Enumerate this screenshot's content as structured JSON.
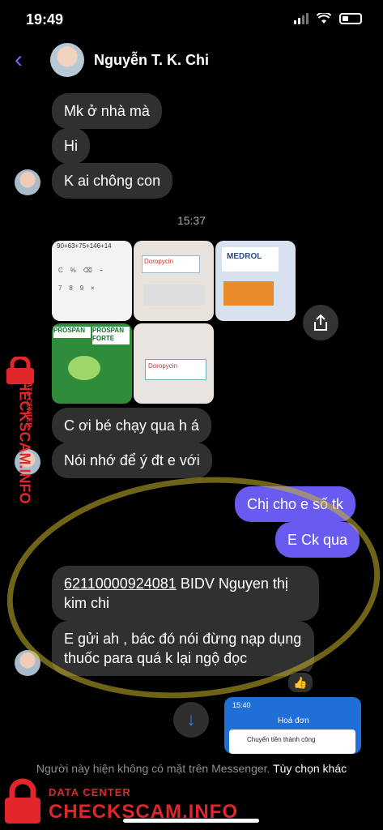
{
  "status_bar": {
    "time": "19:49"
  },
  "header": {
    "contact_name": "Nguyễn T. K. Chi"
  },
  "messages": {
    "in_1": "Mk ở nhà mà",
    "in_2": "Hi",
    "in_3": "K ai chông con",
    "timestamp": "15:37",
    "in_4": "C ơi bé chạy qua h á",
    "in_5": "Nói nhớ để ý đt e với",
    "out_1": "Chị cho e số tk",
    "out_2": "E Ck qua",
    "in_6_account": "62110000924081",
    "in_6_rest": " BIDV Nguyen thị kim chi",
    "in_7": "E gửi ah , bác đó nói đừng nạp dụng thuốc para quá k lại ngộ đọc"
  },
  "photos": {
    "calc_text": "90+63+75+146+14",
    "doropycin": "Doropycin",
    "medrol": "MEDROL",
    "prospan": "PROSPAN",
    "prospan_forte": "PROSPAN FORTE"
  },
  "preview": {
    "time": "15:40",
    "title": "Hoá đơn",
    "row": "Chuyển tiền thành công"
  },
  "reaction": {
    "emoji": "👍"
  },
  "footer": {
    "notice": "Người này hiện không có mặt trên Messenger.",
    "options": "Tùy chọn khác"
  },
  "watermark": {
    "top_line": "DATA CENTER",
    "brand": "CHECKSCAM.INFO"
  },
  "colors": {
    "accent": "#8a5cf6",
    "outgoing": "#6a5bf0",
    "incoming": "#303030",
    "watermark": "#e0262b"
  }
}
